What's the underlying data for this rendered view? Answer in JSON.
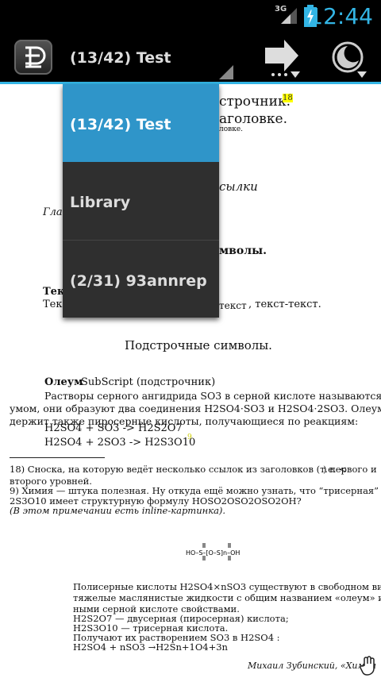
{
  "status_bar": {
    "network": "3G",
    "time": "12:44"
  },
  "app_bar": {
    "title": "(13/42) Test"
  },
  "dropdown": {
    "items": [
      "(13/42) Test",
      "Library",
      "(2/31) 93annrep"
    ]
  },
  "page": {
    "frag1": "строчник.",
    "note18": "18",
    "frag2": "аголовке.",
    "frag3": "ловке.",
    "frag4": "сылки",
    "frag5": "Глав",
    "frag6": "мволы.",
    "frag7": "Текс",
    "frag8": "Текс",
    "frag9": "текст",
    "frag10": ", текст-текст.",
    "subtitle": "Подстрочные символы.",
    "oleum_bold": "Олеум",
    "oleum_rest": "SubScript (подстрочник)",
    "para1": "Растворы серного ангидрида SO3 в серной кислоте называются оле-",
    "para2": "умом, они образуют два соединения H2SO4·SO3 и H2SO4·2SO3. Олеум со-",
    "para3": "держит также пиросерные кислоты, получающиеся по реакциям:",
    "eq1": "H2SO4 + SO3 -> H2S2O7",
    "eq2": "H2SO4 + 2SO3 -> H2S3O10",
    "eq2_note": "9",
    "fn18a": "18) Сноска, на которую ведёт несколько ссылок из заголовков (т.е. <",
    "fn18b": ") первого и",
    "fn18c": "второго уровней.",
    "fn9a": "9) Химия — штука полезная. Ну откуда ещё можно узнать, что “трисерная” кислота H",
    "fn9b": "2S3O10 имеет структурную формулу HOSO2OSO2OSO2OH?",
    "fn9c": "(В этом примечании есть inline-картинка).",
    "formula": "HO–S–[O–S]n–OH",
    "p1": "Полисерные кислоты H2SO4×nSO3 существуют в свободном виде. Это",
    "p2": "тяжелые маслянистые жидкости с общим названием «олеум» и аналогич-",
    "p3": "ными серной кислоте свойствами.",
    "p4": "H2S2O7 — двусерная (пиросерная) кислота;",
    "p5": "H2S3O10 — трисерная кислота.",
    "p6": "Получают их растворением SO3 в H2SO4 :",
    "p7": "H2SO4 + nSO3 →H2Sn+1O4+3n",
    "signature": "Михаил Зубинский, «Химия"
  }
}
